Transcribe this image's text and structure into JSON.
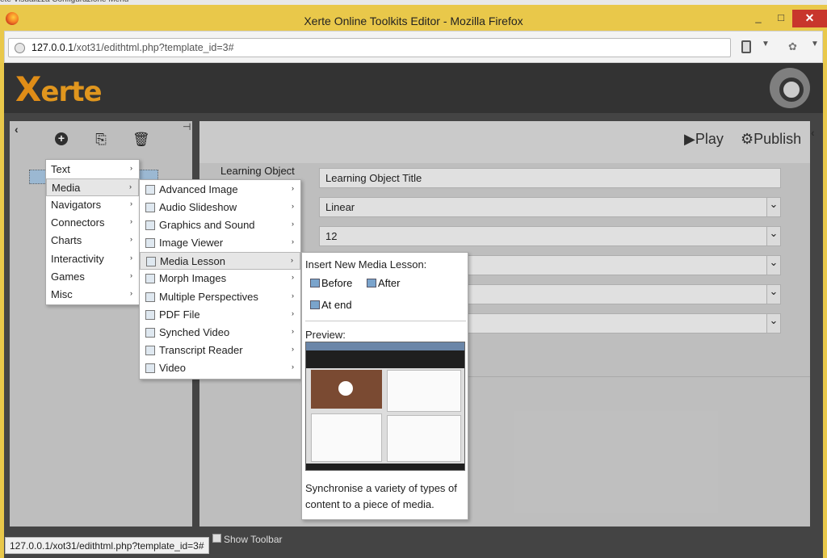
{
  "menubar": {
    "text": "ete  Visualizza  Configurazione  Menu"
  },
  "window": {
    "title": "Xerte Online Toolkits Editor - Mozilla Firefox",
    "minimize": "_",
    "maximize": "□",
    "close": "✕"
  },
  "browser": {
    "url_host": "127.0.0.1",
    "url_path": "/xot31/edithtml.php?template_id=3#"
  },
  "app": {
    "logo": "Xerte",
    "logo_x": "X",
    "logo_rest": "erte",
    "toolbar": {
      "add_icon": "+",
      "duplicate_icon": "⎘",
      "delete_icon": "🗑"
    },
    "play_label": "▶Play",
    "publish_label": "⚙Publish",
    "lo_label": "Learning Object",
    "fields": [
      {
        "value": "Learning Object Title",
        "type": "text"
      },
      {
        "value": "Linear",
        "type": "select"
      },
      {
        "value": "12",
        "type": "select"
      },
      {
        "value": "",
        "type": "select"
      },
      {
        "value": "",
        "type": "select"
      },
      {
        "value": "",
        "type": "select"
      }
    ],
    "show_toolbar": "Show Toolbar",
    "status_url": "127.0.0.1/xot31/edithtml.php?template_id=3#"
  },
  "menu1": {
    "items": [
      "Text",
      "Media",
      "Navigators",
      "Connectors",
      "Charts",
      "Interactivity",
      "Games",
      "Misc"
    ]
  },
  "menu2": {
    "items": [
      "Advanced Image",
      "Audio Slideshow",
      "Graphics and Sound",
      "Image Viewer",
      "Media Lesson",
      "Morph Images",
      "Multiple Perspectives",
      "PDF File",
      "Synched Video",
      "Transcript Reader",
      "Video"
    ]
  },
  "submenu_arrow": "›",
  "panel": {
    "insert_label": "Insert New Media Lesson:",
    "before": "Before",
    "after": "After",
    "at_end": "At end",
    "preview_label": "Preview:",
    "description": "Synchronise a variety of types of content to a piece of media."
  }
}
